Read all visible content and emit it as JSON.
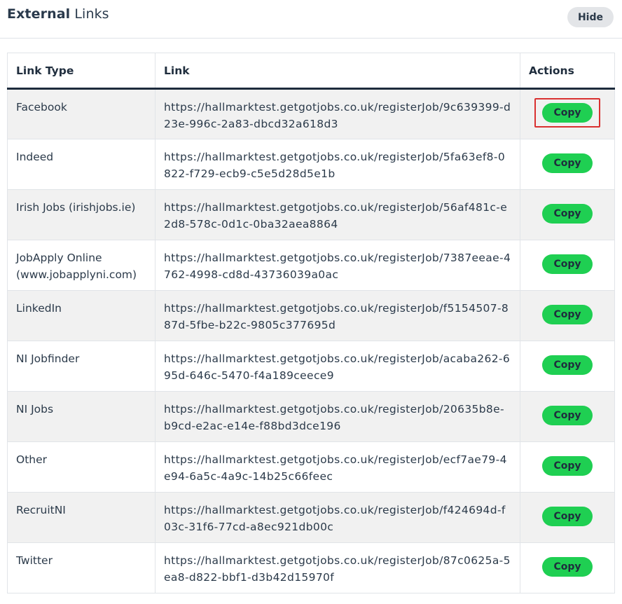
{
  "header": {
    "title_bold": "External",
    "title_rest": " Links",
    "hide_label": "Hide"
  },
  "table": {
    "columns": [
      "Link Type",
      "Link",
      "Actions"
    ],
    "copy_label": "Copy",
    "rows": [
      {
        "type": "Facebook",
        "link": "https://hallmarktest.getgotjobs.co.uk/registerJob/9c639399-d23e-996c-2a83-dbcd32a618d3",
        "highlighted": true
      },
      {
        "type": "Indeed",
        "link": "https://hallmarktest.getgotjobs.co.uk/registerJob/5fa63ef8-0822-f729-ecb9-c5e5d28d5e1b"
      },
      {
        "type": "Irish Jobs (irishjobs.ie)",
        "link": "https://hallmarktest.getgotjobs.co.uk/registerJob/56af481c-e2d8-578c-0d1c-0ba32aea8864"
      },
      {
        "type": "JobApply Online (www.jobapplyni.com)",
        "link": "https://hallmarktest.getgotjobs.co.uk/registerJob/7387eeae-4762-4998-cd8d-43736039a0ac"
      },
      {
        "type": "LinkedIn",
        "link": "https://hallmarktest.getgotjobs.co.uk/registerJob/f5154507-887d-5fbe-b22c-9805c377695d"
      },
      {
        "type": "NI Jobfinder",
        "link": "https://hallmarktest.getgotjobs.co.uk/registerJob/acaba262-695d-646c-5470-f4a189ceece9"
      },
      {
        "type": "NI Jobs",
        "link": "https://hallmarktest.getgotjobs.co.uk/registerJob/20635b8e-b9cd-e2ac-e14e-f88bd3dce196"
      },
      {
        "type": "Other",
        "link": "https://hallmarktest.getgotjobs.co.uk/registerJob/ecf7ae79-4e94-6a5c-4a9c-14b25c66feec"
      },
      {
        "type": "RecruitNI",
        "link": "https://hallmarktest.getgotjobs.co.uk/registerJob/f424694d-f03c-31f6-77cd-a8ec921db00c"
      },
      {
        "type": "Twitter",
        "link": "https://hallmarktest.getgotjobs.co.uk/registerJob/87c0625a-5ea8-d822-bbf1-d3b42d15970f"
      }
    ]
  },
  "colors": {
    "copy_button": "#1fcf52",
    "highlight_border": "#d93030",
    "header_underline": "#1d2b3c",
    "alt_row": "#f1f1f1"
  }
}
